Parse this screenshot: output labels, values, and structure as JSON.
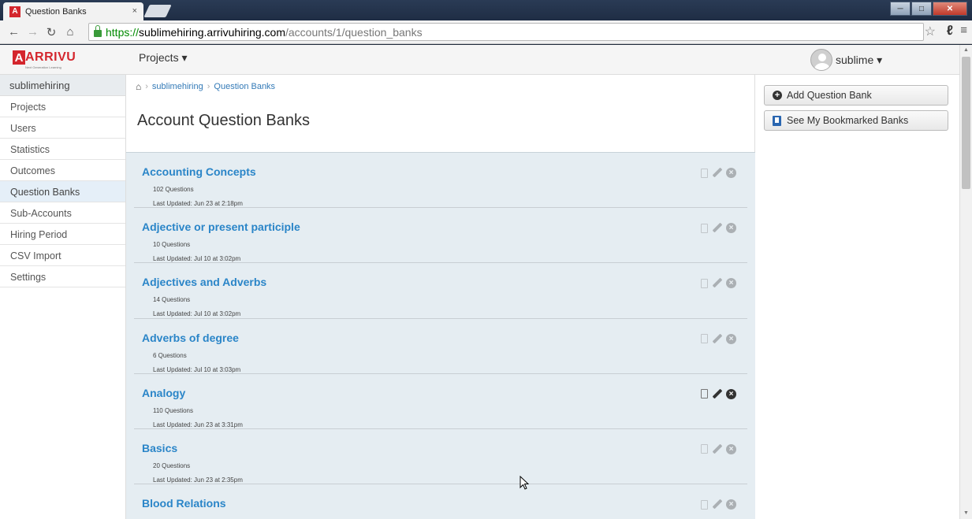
{
  "browser": {
    "tab_title": "Question Banks",
    "tab_close": "×",
    "url_scheme": "https://",
    "url_host": "sublimehiring.arrivuhiring.com",
    "url_path": "/accounts/1/question_banks"
  },
  "app": {
    "logo_text": "ARRIVU",
    "logo_letter": "A",
    "logo_tagline": "Next Generation Learning",
    "projects_menu": "Projects ▾",
    "user_name": "sublime ▾"
  },
  "sidebar": {
    "header": "sublimehiring",
    "items": [
      {
        "label": "Projects"
      },
      {
        "label": "Users"
      },
      {
        "label": "Statistics"
      },
      {
        "label": "Outcomes"
      },
      {
        "label": "Question Banks",
        "active": true
      },
      {
        "label": "Sub-Accounts"
      },
      {
        "label": "Hiring Period"
      },
      {
        "label": "CSV Import"
      },
      {
        "label": "Settings"
      }
    ]
  },
  "breadcrumb": {
    "account": "sublimehiring",
    "current": "Question Banks"
  },
  "page_title": "Account Question Banks",
  "banks": [
    {
      "name": "Accounting Concepts",
      "count": "102 Questions",
      "updated": "Last Updated: Jun 23 at 2:18pm"
    },
    {
      "name": "Adjective or present participle",
      "count": "10 Questions",
      "updated": "Last Updated: Jul 10 at 3:02pm"
    },
    {
      "name": "Adjectives and Adverbs",
      "count": "14 Questions",
      "updated": "Last Updated: Jul 10 at 3:02pm"
    },
    {
      "name": "Adverbs of degree",
      "count": "6 Questions",
      "updated": "Last Updated: Jul 10 at 3:03pm"
    },
    {
      "name": "Analogy",
      "count": "110 Questions",
      "updated": "Last Updated: Jun 23 at 3:31pm",
      "hover": true
    },
    {
      "name": "Basics",
      "count": "20 Questions",
      "updated": "Last Updated: Jun 23 at 2:35pm"
    },
    {
      "name": "Blood Relations",
      "count": "",
      "updated": ""
    }
  ],
  "actions": {
    "add_bank": "Add Question Bank",
    "bookmarked": "See My Bookmarked Banks"
  }
}
